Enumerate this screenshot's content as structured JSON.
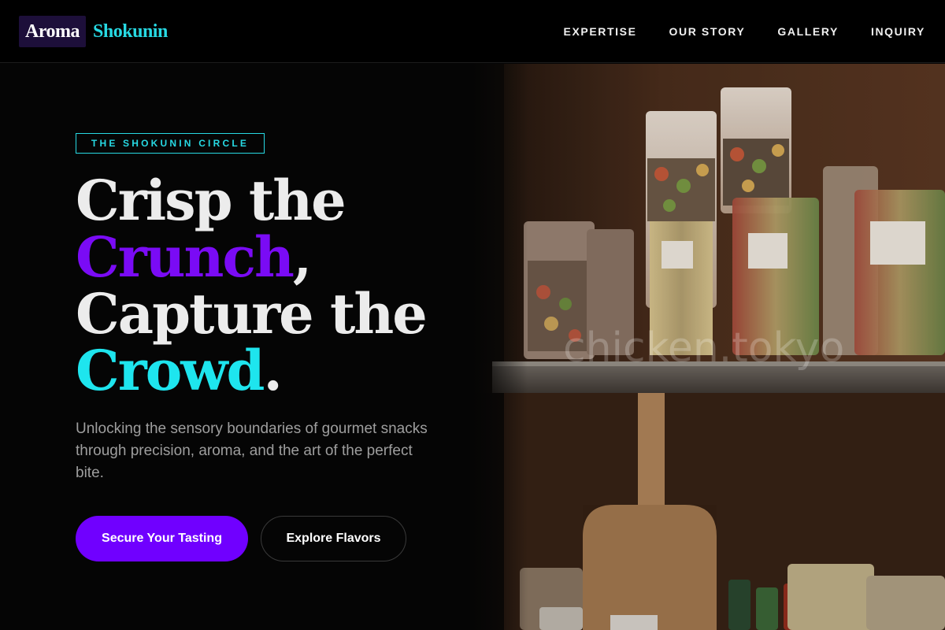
{
  "header": {
    "logo_box": "Aroma",
    "logo_text": "Shokunin",
    "nav": [
      "EXPERTISE",
      "OUR STORY",
      "GALLERY",
      "INQUIRY"
    ]
  },
  "hero": {
    "badge": "THE SHOKUNIN CIRCLE",
    "headline": {
      "line1": "Crisp the",
      "line2_highlight": "Crunch",
      "line2_rest": ",",
      "line3": "Capture the",
      "line4_highlight": "Crowd",
      "line4_rest": "."
    },
    "subtitle": "Unlocking the sensory boundaries of gourmet snacks through precision, aroma, and the art of the perfect bite.",
    "primary_button": "Secure Your Tasting",
    "secondary_button": "Explore Flavors",
    "image_watermark": "chicken.tokyo"
  },
  "colors": {
    "accent_purple": "#7000ff",
    "accent_cyan": "#27d9e3",
    "background": "#050505"
  }
}
